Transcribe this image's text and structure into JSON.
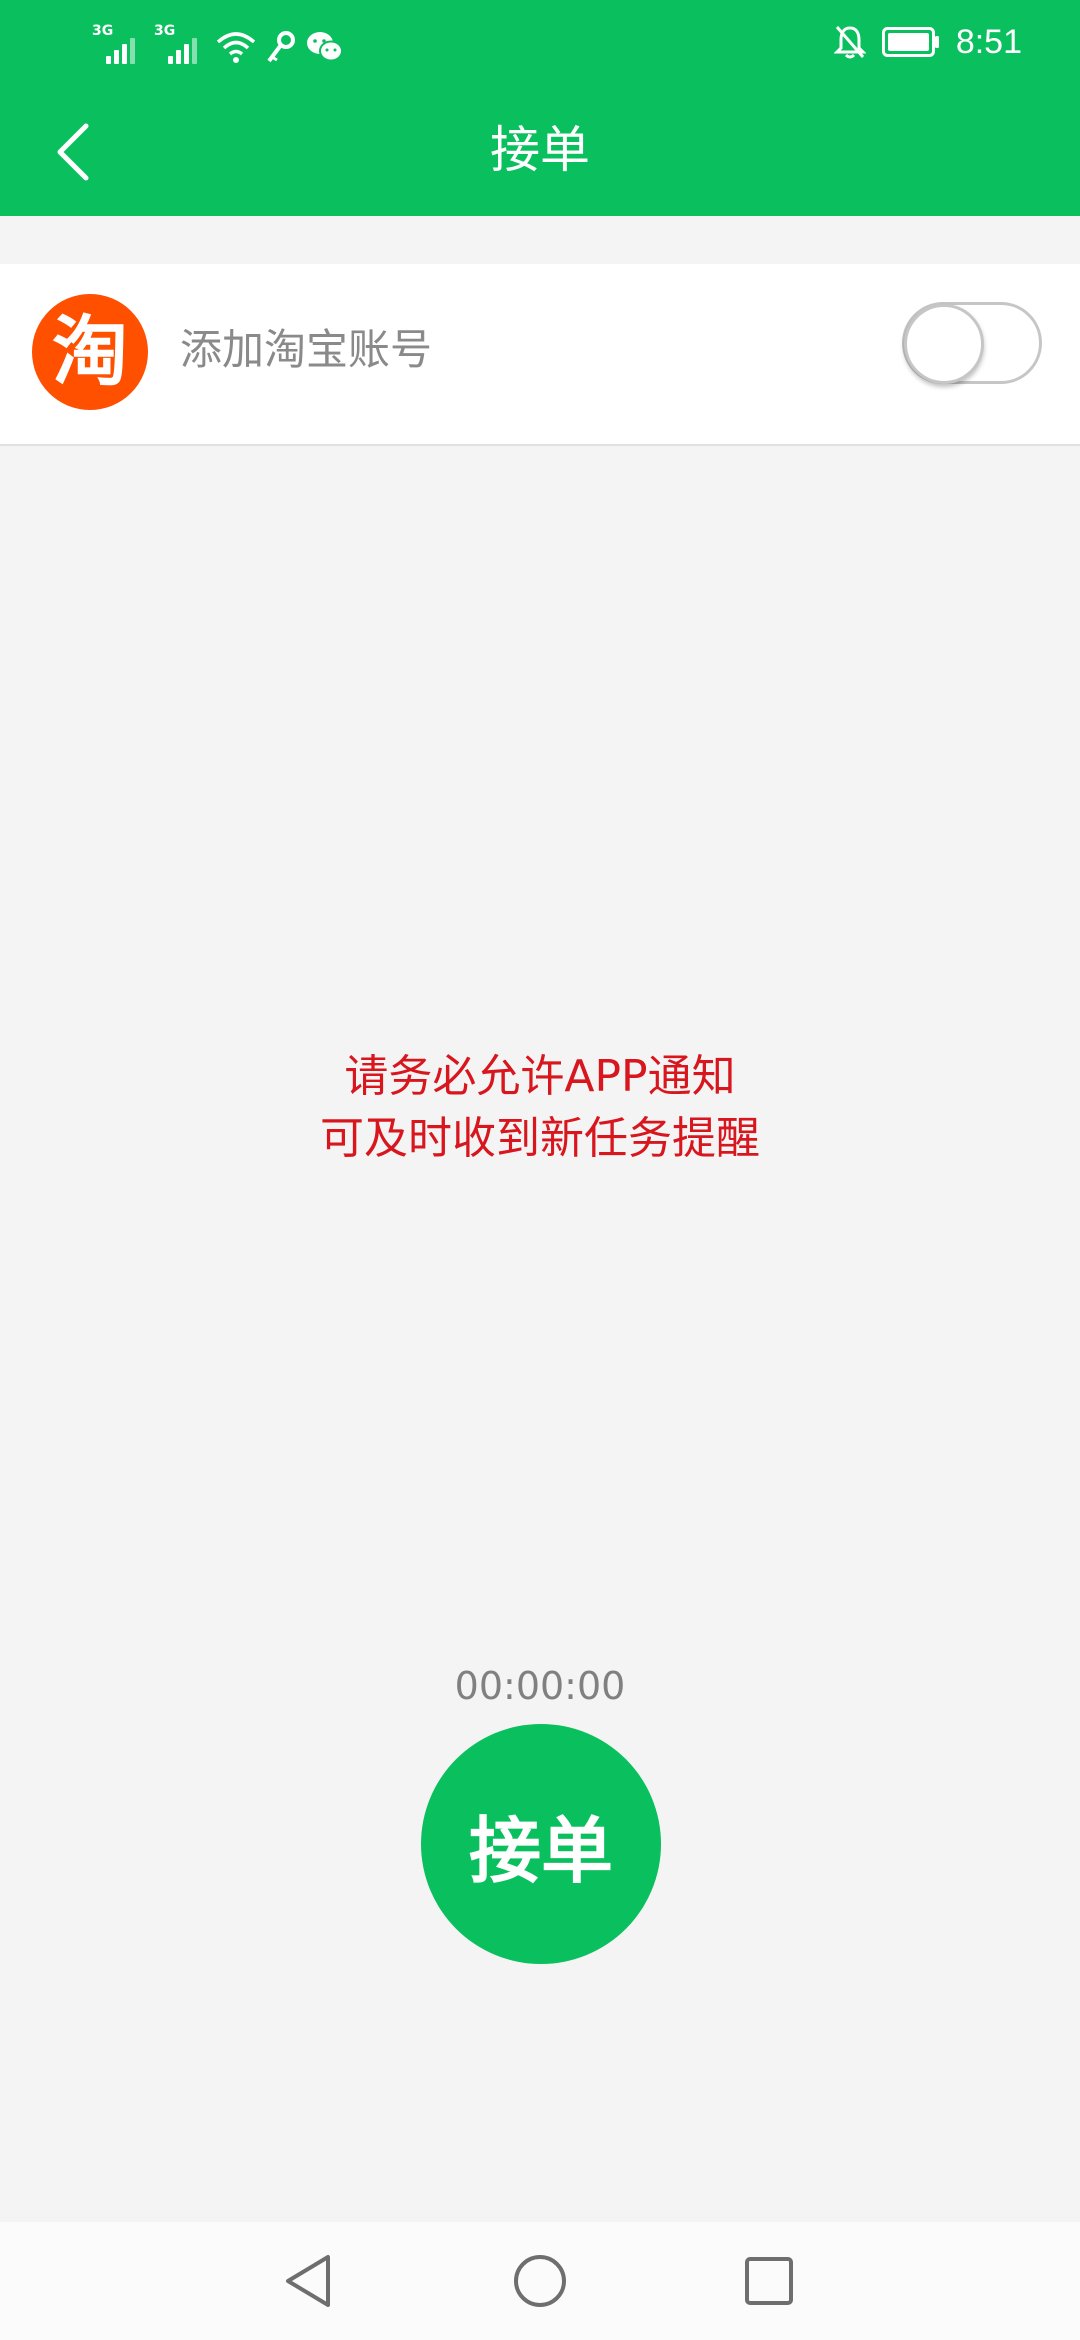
{
  "status_bar": {
    "sim1_network": "3G",
    "sim2_network": "3G",
    "time": "8:51",
    "icons": [
      "signal-icon",
      "signal-icon",
      "wifi-icon",
      "key-icon",
      "wechat-icon",
      "bell-off-icon",
      "battery-icon"
    ]
  },
  "header": {
    "title": "接单",
    "back_icon": "chevron-left-icon",
    "background": "#0ac05e"
  },
  "account": {
    "logo_char": "淘",
    "label": "添加淘宝账号",
    "toggle_on": false,
    "logo_color": "#ff5000"
  },
  "notice": {
    "line1": "请务必允许APP通知",
    "line2": "可及时收到新任务提醒",
    "color": "#d8161e"
  },
  "timer": "00:00:00",
  "accept_button": {
    "label": "接单"
  },
  "nav": {
    "icons": [
      "back-triangle-icon",
      "home-circle-icon",
      "recents-square-icon"
    ]
  }
}
